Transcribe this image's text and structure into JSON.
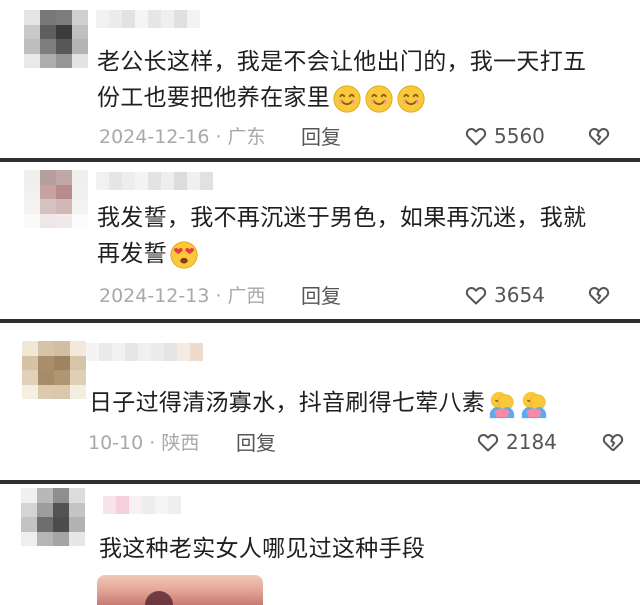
{
  "comments": [
    {
      "text": "老公长这样，我是不会让他出门的，我一天打五份工也要把他养在家里",
      "emojis": [
        "smile-emoji",
        "smile-emoji",
        "smile-emoji"
      ],
      "meta": "2024-12-16 · 广东",
      "reply": "回复",
      "likes": "5560"
    },
    {
      "text": "我发誓，我不再沉迷于男色，如果再沉迷，我就再发誓",
      "emojis": [
        "heart-eyes-emoji"
      ],
      "meta": "2024-12-13 · 广西",
      "reply": "回复",
      "likes": "3654"
    },
    {
      "text": "日子过得清汤寡水，抖音刷得七荤八素",
      "emojis": [
        "hug-emoji",
        "hug-emoji"
      ],
      "meta": "10-10 · 陕西",
      "reply": "回复",
      "likes": "2184"
    },
    {
      "text": "我这种老实女人哪见过这种手段",
      "emojis": [],
      "meta": "",
      "reply": "",
      "likes": ""
    }
  ],
  "colors": {
    "text": "#1f1f1f",
    "meta": "#a9a9a9",
    "action": "#555555",
    "divider": "#2f2f2f",
    "emoji_yellow": "#f9c93b",
    "emoji_heart": "#ea3b46",
    "emoji_hug_pink": "#f58ba8",
    "emoji_hug_blue": "#5ea9ef"
  },
  "icons": {
    "like": "heart-outline-icon",
    "dislike": "broken-heart-icon"
  }
}
